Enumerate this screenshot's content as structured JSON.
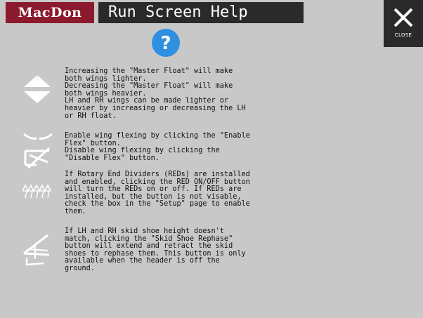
{
  "header": {
    "logo_text": "MacDon",
    "title": "Run Screen Help"
  },
  "close_button": {
    "label": "CLOSE",
    "icon": "close-icon"
  },
  "help_icon": "question-mark-icon",
  "colors": {
    "background": "#c8c8c8",
    "brand": "#8b1a2e",
    "title_bar": "#2a2a2a",
    "help_blue": "#2f8fe0"
  },
  "help_items": [
    {
      "icon": "float-up-down-icon",
      "text": "Increasing the \"Master Float\" will make\nboth wings lighter.\nDecreasing the \"Master Float\" will make\nboth wings heavier.\nLH and RH wings can be made lighter or\nheavier by increasing or decreasing the LH\nor RH float."
    },
    {
      "icon": "wing-flex-icon",
      "text": "Enable wing flexing by clicking the \"Enable\nFlex\" button.\nDisable wing flexing by clicking the\n\"Disable Flex\" button."
    },
    {
      "icon": "rotary-end-divider-icon",
      "text": "If Rotary End Dividers (REDs) are installed\nand enabled, clicking the RED ON/OFF button\nwill turn the REDs on or off. If REDs are\ninstalled, but the button is not visable,\ncheck the box in the \"Setup\" page to enable\nthem."
    },
    {
      "icon": "skid-shoe-icon",
      "text": "If LH and RH skid shoe height doesn't\nmatch, clicking the \"Skid Shoe Rephase\"\nbutton will extend and retract the skid\nshoes to rephase them. This button is only\navailable when the header is off the\nground."
    }
  ]
}
